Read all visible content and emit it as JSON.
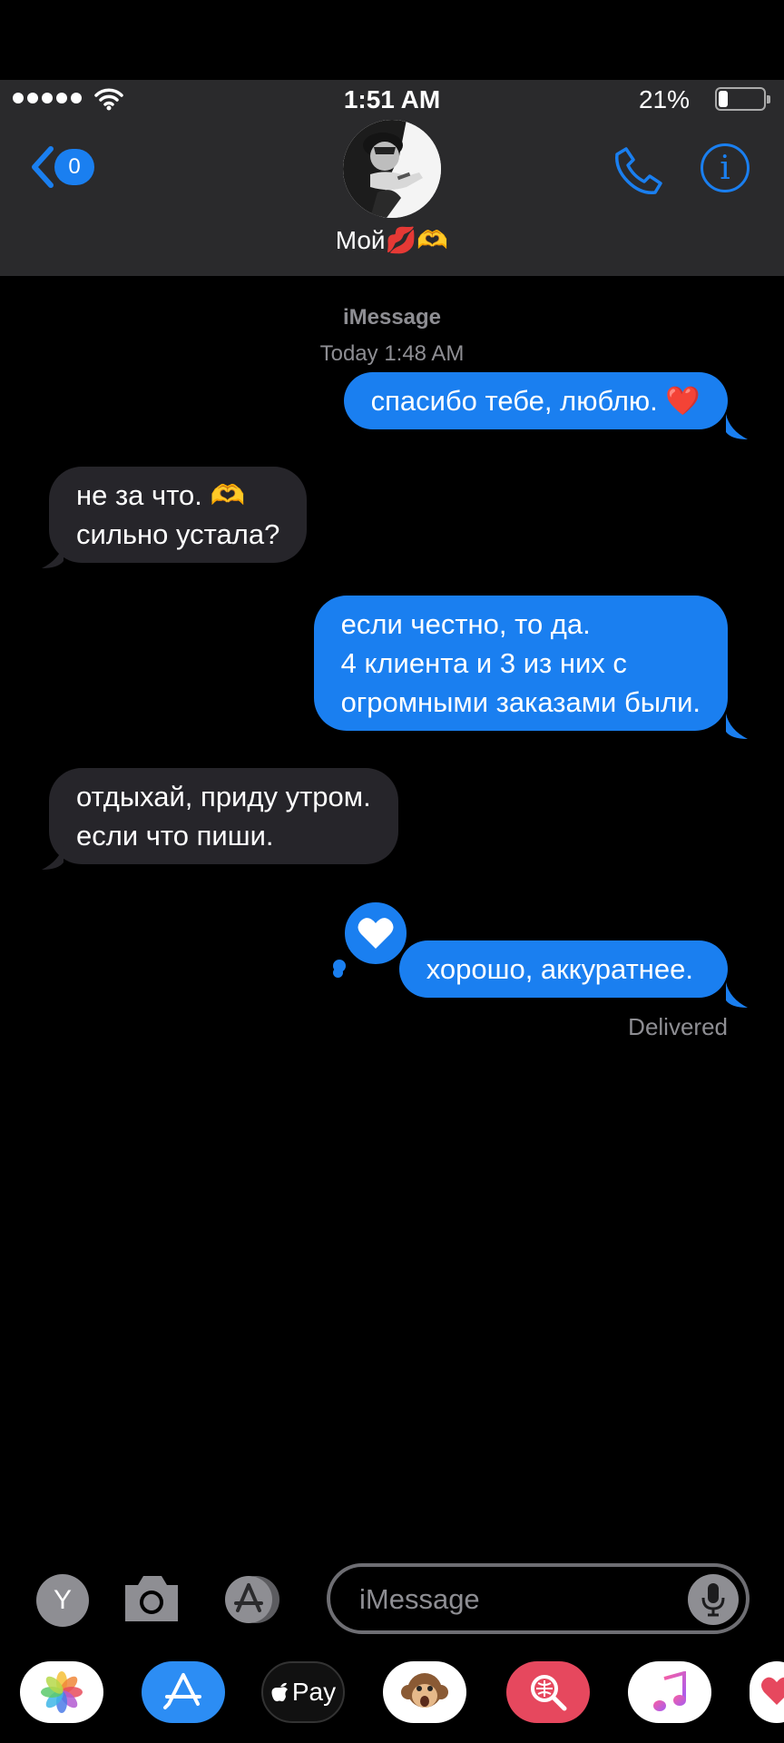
{
  "status_bar": {
    "time": "1:51 AM",
    "battery_percent": "21%",
    "battery_level": 0.21
  },
  "header": {
    "back_badge": "0",
    "contact_name": "Мой💋🫶"
  },
  "thread": {
    "service": "iMessage",
    "timestamp": "Today 1:48 AM",
    "messages": [
      {
        "direction": "outgoing",
        "lines": [
          "спасибо тебе, люблю. ❤️"
        ]
      },
      {
        "direction": "incoming",
        "lines": [
          "не за что. 🫶",
          "сильно устала?"
        ]
      },
      {
        "direction": "outgoing",
        "lines": [
          "если честно, то да.",
          "4 клиента и 3 из них с",
          "огромными заказами были."
        ]
      },
      {
        "direction": "incoming",
        "lines": [
          "отдыхай, приду утром.",
          "если что пиши."
        ]
      },
      {
        "direction": "outgoing",
        "lines": [
          "хорошо, аккуратнее."
        ],
        "tapback": "heart-icon"
      }
    ],
    "delivered": "Delivered"
  },
  "input": {
    "avatar_letter": "Y",
    "placeholder": "iMessage"
  },
  "tray": {
    "apps": [
      "photos-app-icon",
      "app-store-icon",
      "apple-pay-icon",
      "animoji-icon",
      "image-search-icon",
      "music-icon",
      "digital-touch-icon"
    ],
    "apple_pay_label": "Pay"
  },
  "colors": {
    "accent": "#1a7ff0",
    "incoming_bubble": "#26252a",
    "header_bg": "#2a2a2c"
  }
}
